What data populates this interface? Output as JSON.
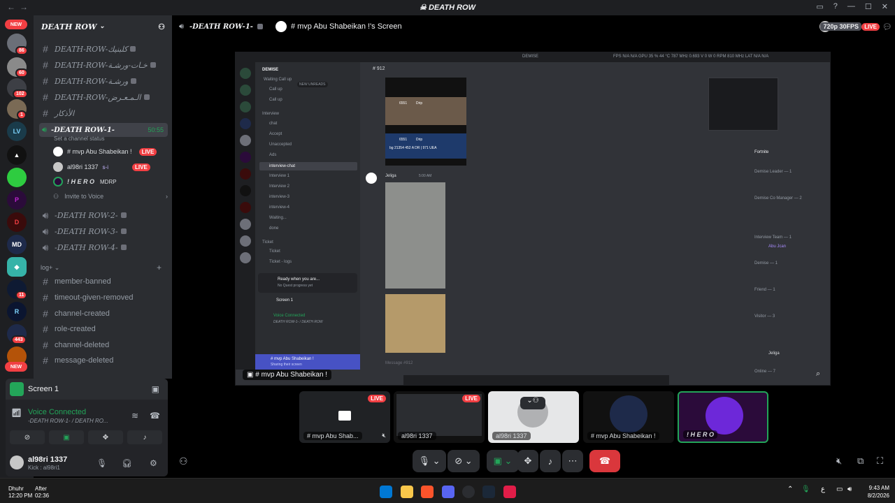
{
  "window": {
    "title": "DEATH ROW"
  },
  "guild_badges": {
    "new_top": "NEW",
    "g1": "86",
    "g2": "60",
    "g3": "102",
    "g4": "1",
    "g5": "11",
    "g6": "443",
    "new_bottom": "NEW"
  },
  "server": {
    "name": "DEATH ROW",
    "channels": [
      {
        "name": "DEATH-ROW-كلبنيك",
        "type": "text"
      },
      {
        "name": "DEATH-ROW-خـات-ورشـة",
        "type": "text"
      },
      {
        "name": "DEATH-ROW-ورشـة",
        "type": "text"
      },
      {
        "name": "DEATH-ROW-الـمـعـرض",
        "type": "text"
      },
      {
        "name": "الأذكار",
        "type": "text"
      }
    ],
    "active_voice": {
      "name": "-DEATH ROW-1-",
      "timer": "50:55",
      "status": "Set a channel status"
    },
    "members": [
      {
        "name": "# mvp Abu Shabeikan !",
        "badge": "LIVE"
      },
      {
        "name": "al98ri 1337",
        "tag": "s-i",
        "badge": "LIVE"
      },
      {
        "name": "! H E R O",
        "tag": "MDRP"
      }
    ],
    "invite": "Invite to Voice",
    "voice_channels": [
      "-DEATH ROW-2-",
      "-DEATH ROW-3-",
      "-DEATH ROW-4-"
    ],
    "category": "log+",
    "log_channels": [
      "member-banned",
      "timeout-given-removed",
      "channel-created",
      "role-created",
      "channel-deleted",
      "message-deleted"
    ]
  },
  "panel": {
    "screen": "Screen 1",
    "voice_connected": "Voice Connected",
    "voice_path": "-DEATH ROW-1- / DEATH RO...",
    "user": "al98ri 1337",
    "user_status": "Kick : al98ri1"
  },
  "stage": {
    "voice_channel": "-DEATH ROW-1-",
    "stream_title": "# mvp Abu Shabeikan !'s Screen",
    "quality": "720p 30FPS",
    "live": "LIVE",
    "caption": "# mvp Abu Shabeikan !"
  },
  "inner": {
    "app_title": "DEMISE",
    "stats": "FPS N/A N/A   GPU 35 % 44 °C 787 MHz 0.693 V 0 W 0 RPM 810 MHz   LAT N/A N/A",
    "server_name": "DEMISE",
    "channel_head": "912",
    "new_unreads": "NEW UNREADS",
    "channels": [
      "Waiting Call up",
      "Call up",
      "Call up",
      "Interview",
      "chat",
      "Accept",
      "Unaccepted",
      "Ads",
      "interview-chat",
      "Interview 1",
      "Interview 2",
      "interview-3",
      "interview-4",
      "Waiting...",
      "done",
      "Ticket",
      "Ticket",
      "Ticket - logs"
    ],
    "ready": "Ready when you are...",
    "ready_sub": "No Quest progress yet",
    "screen": "Screen 1",
    "vc": "Voice Connected",
    "vc_path": "DEATH ROW-1- / DEATH ROW",
    "user": "# mvp Abu Shabeikan !",
    "user_sub": "Sharing their screen",
    "msg_user": "Jeliga",
    "msg_time": "5:00 AM",
    "card1_id": "6551",
    "card1_tag": "Drip",
    "card2_id": "6551",
    "card2_tag": "Drip",
    "card2_text": "bg 21354 452 A DR | 971 UEA",
    "placeholder": "Message #912",
    "member_groups": [
      "Demise Leader — 1",
      "Demise Co Manager — 2",
      "Interview Team — 1",
      "Demise — 1",
      "Friend — 1",
      "Visitor — 3",
      "Online — 7"
    ],
    "member_names": [
      "Fortnite",
      "Abu Jcan",
      "Jeliga"
    ]
  },
  "tiles": [
    {
      "name": "# mvp Abu Shab...",
      "badge": "LIVE"
    },
    {
      "name": "al98ri 1337",
      "badge": "LIVE"
    },
    {
      "name": "al98ri 1337"
    },
    {
      "name": "# mvp Abu Shabeikan !"
    },
    {
      "name": "! H E R O"
    }
  ],
  "taskbar": {
    "prayer": "Dhuhr",
    "prayer_time": "12:20 PM",
    "after": "After",
    "after_time": "02:36",
    "time": "9:43 AM",
    "date": "8/2/2026",
    "lang": "ع"
  },
  "colors": {
    "live": "#f23f43",
    "green": "#23a559",
    "blurple": "#5865f2"
  }
}
